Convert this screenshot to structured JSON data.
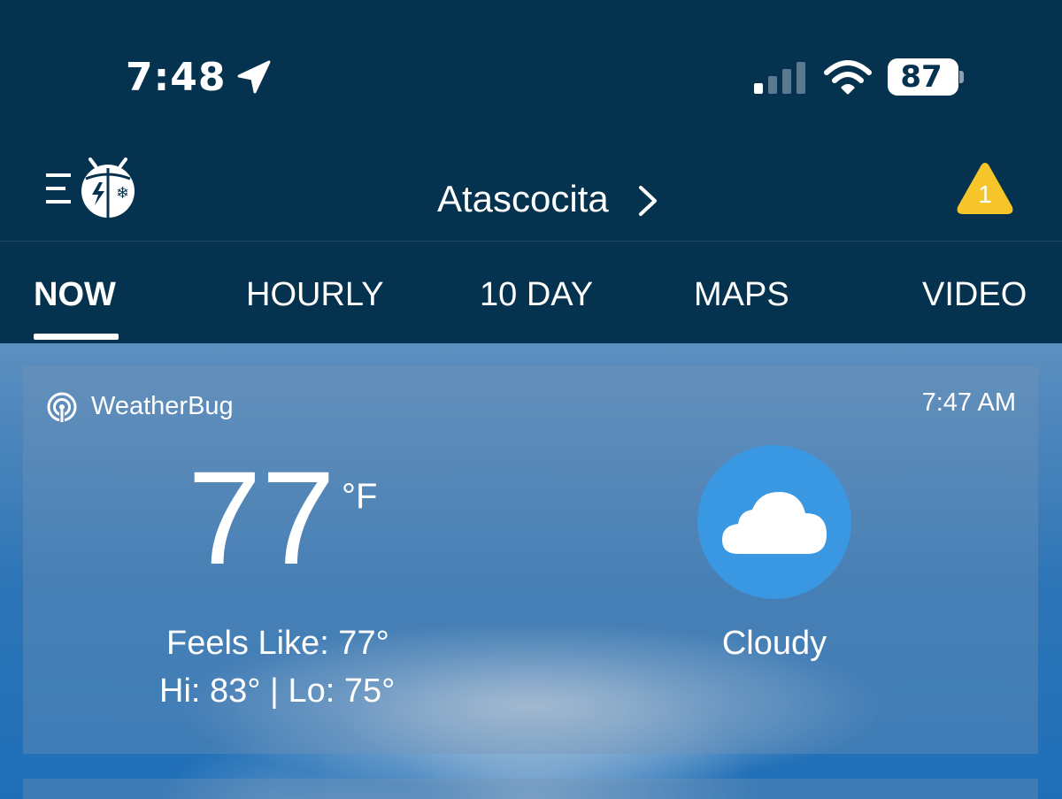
{
  "status_bar": {
    "time": "7:48",
    "battery": "87",
    "icons": [
      "location-arrow-icon",
      "cellular-signal-icon",
      "wifi-icon",
      "battery-icon"
    ]
  },
  "header": {
    "location": "Atascocita",
    "alert_count": "1",
    "alert_color": "#f5c52a",
    "background_color": "#05324f"
  },
  "tabs": [
    {
      "label": "NOW",
      "active": true
    },
    {
      "label": "HOURLY"
    },
    {
      "label": "10 DAY"
    },
    {
      "label": "MAPS"
    },
    {
      "label": "VIDEO"
    }
  ],
  "current": {
    "provider": "WeatherBug",
    "time": "7:47 AM",
    "temperature": "77",
    "unit": "°F",
    "feels_like": "Feels Like: 77°",
    "hi_lo": "Hi: 83° | Lo: 75°",
    "condition": "Cloudy",
    "condition_icon": "cloud-icon",
    "condition_icon_bg": "#3a97e2"
  }
}
